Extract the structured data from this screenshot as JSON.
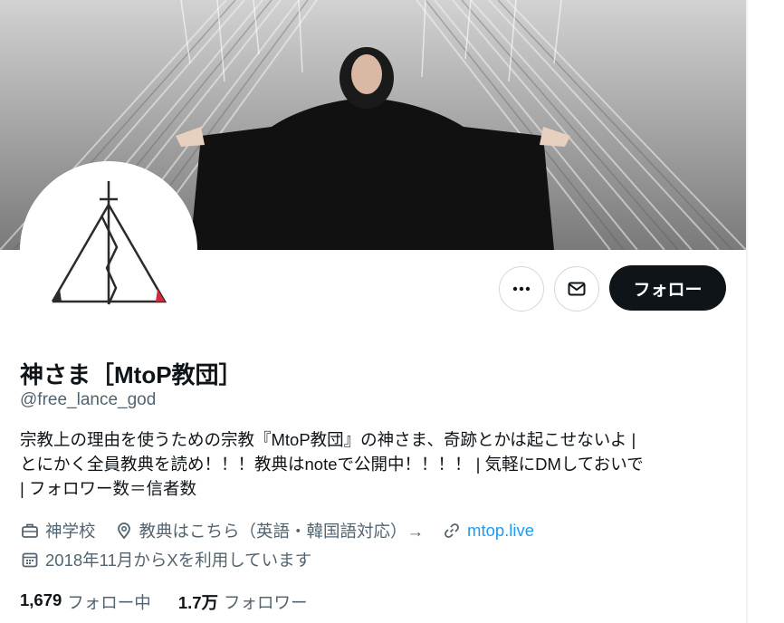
{
  "profile": {
    "display_name": "神さま［MtoP教団］",
    "handle": "@free_lance_god",
    "bio_lines": [
      "宗教上の理由を使うための宗教『MtoP教団』の神さま、奇跡とかは起こせないよ |",
      "とにかく全員教典を読め！！！教典はnoteで公開中！！！！ | 気軽にDMしておいで",
      "| フォロワー数＝信者数"
    ],
    "category": "神学校",
    "location": "教典はこちら（英語・韓国語対応）→",
    "website": "mtop.live",
    "joined": "2018年11月からXを利用しています"
  },
  "actions": {
    "more_icon": "more-horizontal-icon",
    "message_icon": "envelope-icon",
    "follow_label": "フォロー"
  },
  "stats": {
    "following_count": "1,679",
    "following_label": "フォロー中",
    "followers_count": "1.7万",
    "followers_label": "フォロワー"
  },
  "colors": {
    "text_primary": "#0f1419",
    "text_secondary": "#536471",
    "link": "#1d9bf0",
    "follow_button_bg": "#0f1419",
    "border": "#cfd9de"
  }
}
